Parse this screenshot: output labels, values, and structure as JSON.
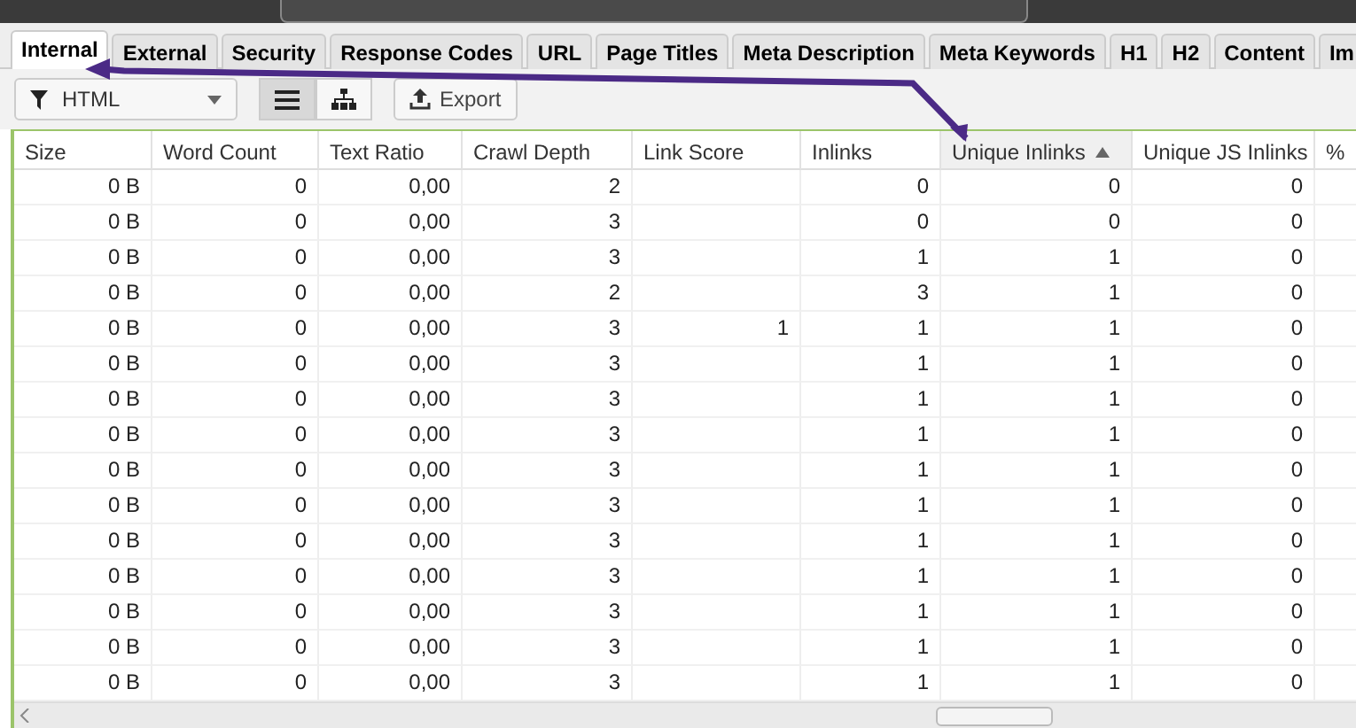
{
  "tabs": [
    {
      "label": "Internal",
      "selected": true
    },
    {
      "label": "External",
      "selected": false
    },
    {
      "label": "Security",
      "selected": false
    },
    {
      "label": "Response Codes",
      "selected": false
    },
    {
      "label": "URL",
      "selected": false
    },
    {
      "label": "Page Titles",
      "selected": false
    },
    {
      "label": "Meta Description",
      "selected": false
    },
    {
      "label": "Meta Keywords",
      "selected": false
    },
    {
      "label": "H1",
      "selected": false
    },
    {
      "label": "H2",
      "selected": false
    },
    {
      "label": "Content",
      "selected": false
    },
    {
      "label": "Im",
      "selected": false
    }
  ],
  "toolbar": {
    "filter": "HTML",
    "views": [
      {
        "kind": "list",
        "selected": true
      },
      {
        "kind": "tree",
        "selected": false
      }
    ],
    "export": "Export"
  },
  "table": {
    "columns": [
      {
        "label": "Size",
        "sorted": false
      },
      {
        "label": "Word Count",
        "sorted": false
      },
      {
        "label": "Text Ratio",
        "sorted": false
      },
      {
        "label": "Crawl Depth",
        "sorted": false
      },
      {
        "label": "Link Score",
        "sorted": false
      },
      {
        "label": "Inlinks",
        "sorted": false
      },
      {
        "label": "Unique Inlinks",
        "sorted": true
      },
      {
        "label": "Unique JS Inlinks",
        "sorted": false
      },
      {
        "label": "%",
        "sorted": false
      }
    ],
    "rows": [
      [
        "0 B",
        "0",
        "0,00",
        "2",
        "",
        "0",
        "0",
        "0"
      ],
      [
        "0 B",
        "0",
        "0,00",
        "3",
        "",
        "0",
        "0",
        "0"
      ],
      [
        "0 B",
        "0",
        "0,00",
        "3",
        "",
        "1",
        "1",
        "0"
      ],
      [
        "0 B",
        "0",
        "0,00",
        "2",
        "",
        "3",
        "1",
        "0"
      ],
      [
        "0 B",
        "0",
        "0,00",
        "3",
        "1",
        "1",
        "1",
        "0"
      ],
      [
        "0 B",
        "0",
        "0,00",
        "3",
        "",
        "1",
        "1",
        "0"
      ],
      [
        "0 B",
        "0",
        "0,00",
        "3",
        "",
        "1",
        "1",
        "0"
      ],
      [
        "0 B",
        "0",
        "0,00",
        "3",
        "",
        "1",
        "1",
        "0"
      ],
      [
        "0 B",
        "0",
        "0,00",
        "3",
        "",
        "1",
        "1",
        "0"
      ],
      [
        "0 B",
        "0",
        "0,00",
        "3",
        "",
        "1",
        "1",
        "0"
      ],
      [
        "0 B",
        "0",
        "0,00",
        "3",
        "",
        "1",
        "1",
        "0"
      ],
      [
        "0 B",
        "0",
        "0,00",
        "3",
        "",
        "1",
        "1",
        "0"
      ],
      [
        "0 B",
        "0",
        "0,00",
        "3",
        "",
        "1",
        "1",
        "0"
      ],
      [
        "0 B",
        "0",
        "0,00",
        "3",
        "",
        "1",
        "1",
        "0"
      ],
      [
        "0 B",
        "0",
        "0,00",
        "3",
        "",
        "1",
        "1",
        "0"
      ]
    ]
  }
}
